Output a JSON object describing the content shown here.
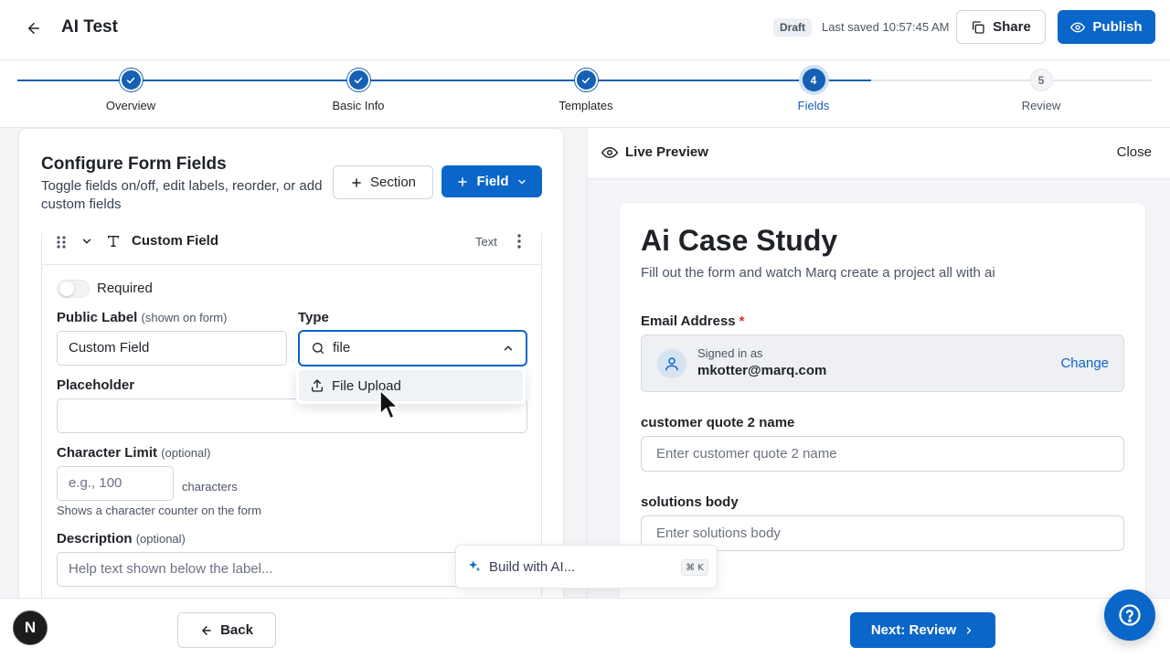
{
  "header": {
    "title": "AI Test",
    "draft_badge": "Draft",
    "last_saved": "Last saved 10:57:45 AM",
    "share_label": "Share",
    "publish_label": "Publish"
  },
  "stepper": {
    "steps": [
      {
        "label": "Overview",
        "state": "done"
      },
      {
        "label": "Basic Info",
        "state": "done"
      },
      {
        "label": "Templates",
        "state": "done"
      },
      {
        "label": "Fields",
        "number": "4",
        "state": "current"
      },
      {
        "label": "Review",
        "number": "5",
        "state": "todo"
      }
    ]
  },
  "config": {
    "title": "Configure Form Fields",
    "subtitle": "Toggle fields on/off, edit labels, reorder, or add custom fields",
    "section_label": "Section",
    "field_label": "Field",
    "field_card": {
      "name": "Custom Field",
      "type_tag": "Text",
      "required_label": "Required",
      "public_label": "Public Label",
      "public_label_hint": "(shown on form)",
      "public_label_value": "Custom Field",
      "type_label": "Type",
      "type_search_value": "file",
      "placeholder_label": "Placeholder",
      "placeholder_value": "",
      "char_limit_label": "Character Limit",
      "char_limit_hint": "(optional)",
      "char_limit_placeholder": "e.g., 100",
      "chars_suffix": "characters",
      "char_help": "Shows a character counter on the form",
      "description_label": "Description",
      "description_hint": "(optional)",
      "description_placeholder": "Help text shown below the label..."
    },
    "type_dropdown": {
      "options": [
        "File Upload"
      ]
    }
  },
  "ai_popup": {
    "label": "Build with AI...",
    "shortcut": "⌘ K"
  },
  "preview": {
    "title": "Live Preview",
    "close_label": "Close",
    "form": {
      "title": "Ai Case Study",
      "description": "Fill out the form and watch Marq create a project all with ai",
      "email_label": "Email Address",
      "required_mark": "*",
      "signed_in_as": "Signed in as",
      "email": "mkotter@marq.com",
      "change_label": "Change",
      "field2_label": "customer quote 2 name",
      "field2_placeholder": "Enter customer quote 2 name",
      "field3_label": "solutions body",
      "field3_placeholder": "Enter solutions body"
    }
  },
  "footer": {
    "logo_letter": "N",
    "back_label": "Back",
    "next_label": "Next: Review"
  },
  "colors": {
    "primary": "#0a66c8",
    "step_done": "#1560b3",
    "required": "#d93025"
  }
}
